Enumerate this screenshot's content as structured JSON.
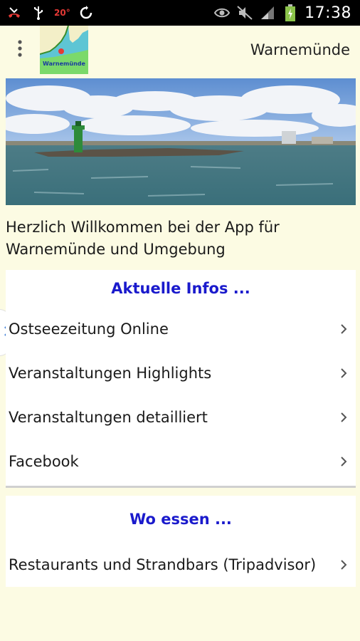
{
  "status_bar": {
    "temperature": "20°",
    "time": "17:38",
    "icons": [
      "missed-call-icon",
      "usb-icon",
      "sync-icon",
      "eye-icon",
      "mute-icon",
      "signal-icon",
      "battery-charging-icon"
    ]
  },
  "action_bar": {
    "logo_text": "Warnemünde",
    "title": "Warnemünde",
    "overflow_icon": "more-vert-icon"
  },
  "welcome_text": "Herzlich Willkommen bei der App für Warnemünde und Umgebung",
  "sections": [
    {
      "header": "Aktuelle Infos ...",
      "items": [
        {
          "label": "Ostseezeitung Online"
        },
        {
          "label": "Veranstaltungen Highlights"
        },
        {
          "label": "Veranstaltungen detailliert"
        },
        {
          "label": "Facebook"
        }
      ]
    },
    {
      "header": "Wo essen ...",
      "items": [
        {
          "label": "Restaurants und Strandbars (Tripadvisor)"
        }
      ]
    }
  ],
  "colors": {
    "background": "#fcfbe3",
    "section_header": "#1a1acc",
    "status_bar": "#000000"
  }
}
